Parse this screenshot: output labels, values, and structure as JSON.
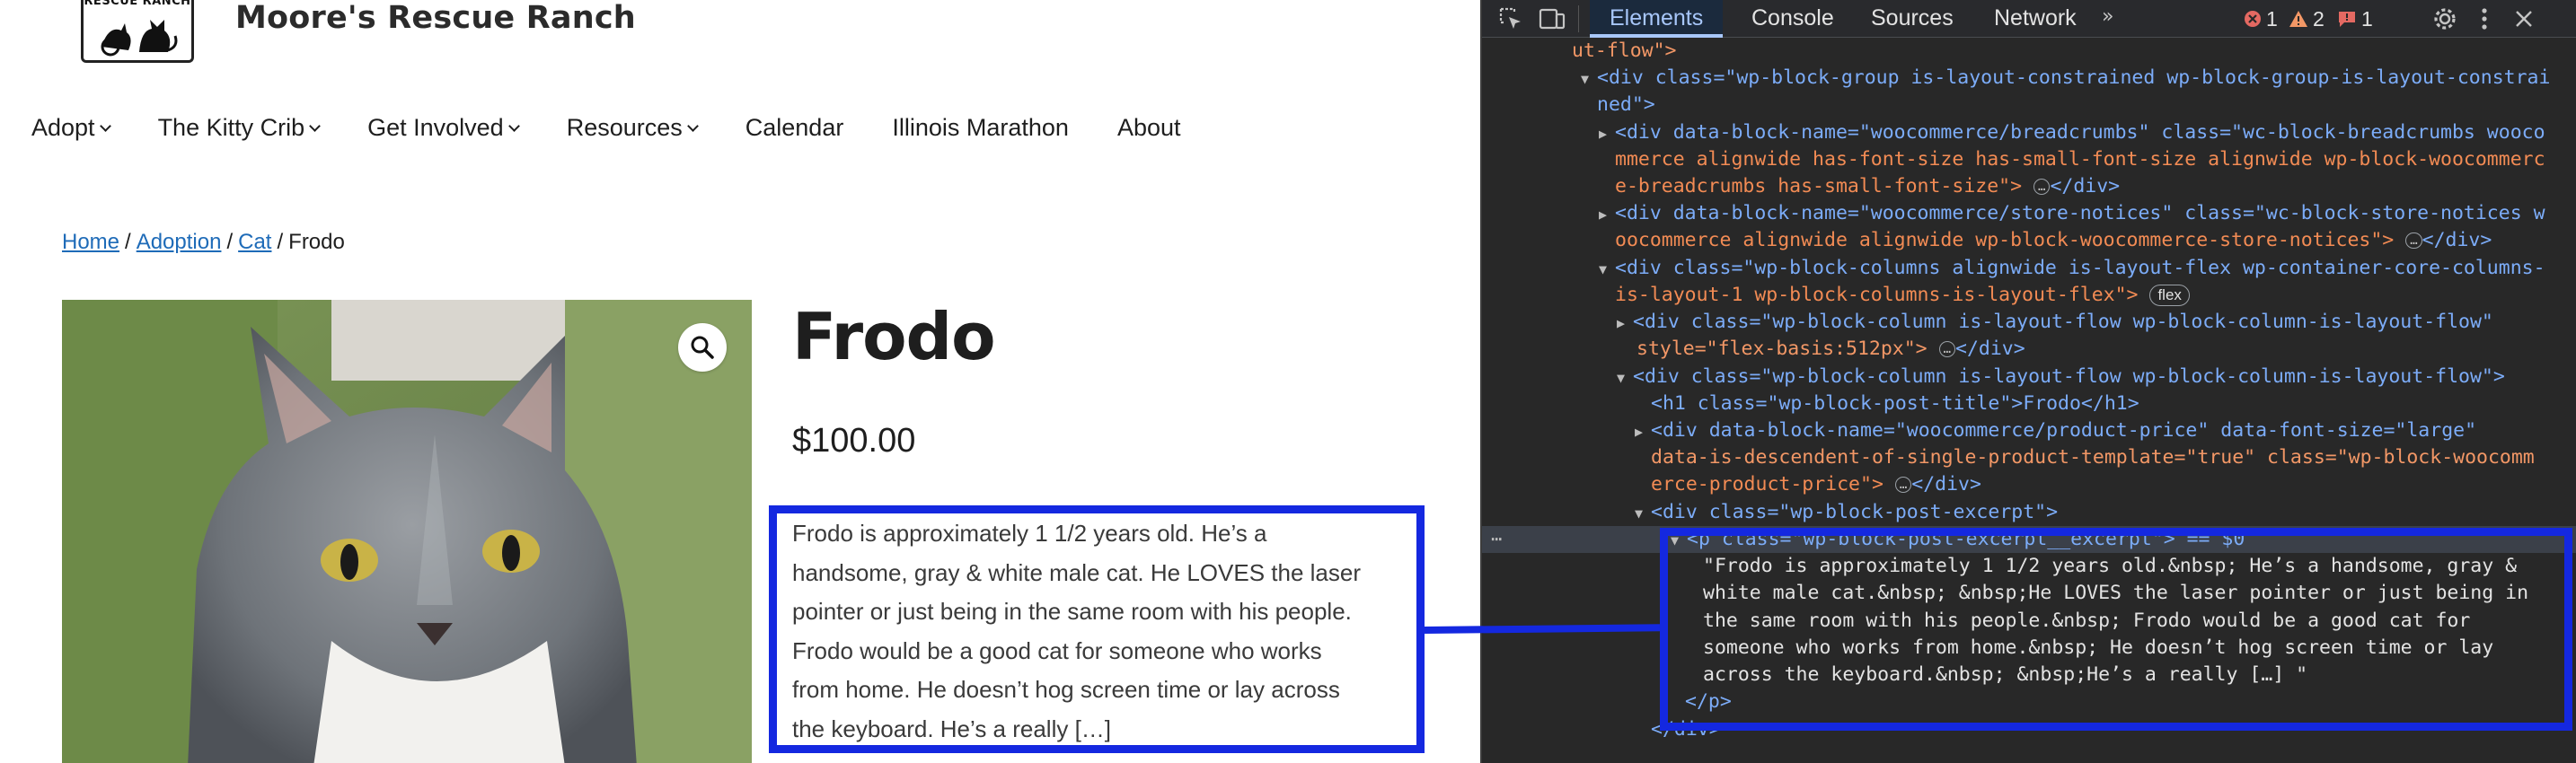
{
  "site": {
    "logo_text": "RESCUE RANCH",
    "title": "Moore's Rescue Ranch",
    "nav": [
      {
        "label": "Adopt",
        "has_dropdown": true
      },
      {
        "label": "The Kitty Crib",
        "has_dropdown": true
      },
      {
        "label": "Get Involved",
        "has_dropdown": true
      },
      {
        "label": "Resources",
        "has_dropdown": true
      },
      {
        "label": "Calendar",
        "has_dropdown": false
      },
      {
        "label": "Illinois Marathon",
        "has_dropdown": false
      },
      {
        "label": "About",
        "has_dropdown": false
      }
    ],
    "breadcrumb": {
      "links": [
        "Home",
        "Adoption",
        "Cat"
      ],
      "separator": "/",
      "current": "Frodo"
    },
    "product": {
      "title": "Frodo",
      "price": "$100.00",
      "excerpt_lines": [
        "Frodo is approximately 1 1/2 years old.  He’s a",
        "handsome, gray & white male cat.   He LOVES the laser",
        "pointer or just being in the same room with his people.",
        "Frodo would be a good cat for someone who works",
        "from home.  He doesn’t hog screen time or lay across",
        "the keyboard.   He’s a really […]"
      ],
      "zoom_icon": "magnifier-icon"
    },
    "highlight_color": "#1428e0"
  },
  "devtools": {
    "tabs": [
      "Elements",
      "Console",
      "Sources",
      "Network"
    ],
    "active_tab": "Elements",
    "more_tabs": "»",
    "errors": "1",
    "warnings": "2",
    "issues": "1",
    "lines": [
      {
        "text": "ut-flow\">"
      },
      {
        "text": "<div class=\"wp-block-group is-layout-constrained wp-block-group-is-layout-constrai"
      },
      {
        "text": "ned\">"
      },
      {
        "text": "<div data-block-name=\"woocommerce/breadcrumbs\" class=\"wc-block-breadcrumbs wooco"
      },
      {
        "text": "mmerce alignwide has-font-size has-small-font-size alignwide wp-block-woocommerc"
      },
      {
        "text": "e-breadcrumbs has-small-font-size\">"
      },
      {
        "text": "<div data-block-name=\"woocommerce/store-notices\" class=\"wc-block-store-notices w"
      },
      {
        "text": "oocommerce alignwide alignwide wp-block-woocommerce-store-notices\">"
      },
      {
        "text": "<div class=\"wp-block-columns alignwide is-layout-flex wp-container-core-columns-"
      },
      {
        "text": "is-layout-1 wp-block-columns-is-layout-flex\">"
      },
      {
        "text": "<div class=\"wp-block-column is-layout-flow wp-block-column-is-layout-flow\""
      },
      {
        "text": "style=\"flex-basis:512px\">"
      },
      {
        "text": "<div class=\"wp-block-column is-layout-flow wp-block-column-is-layout-flow\">"
      },
      {
        "text": "<h1 class=\"wp-block-post-title\">Frodo</h1>"
      },
      {
        "text": "<div data-block-name=\"woocommerce/product-price\" data-font-size=\"large\""
      },
      {
        "text": "data-is-descendent-of-single-product-template=\"true\" class=\"wp-block-woocomm"
      },
      {
        "text": "erce-product-price\">"
      },
      {
        "text": "<div class=\"wp-block-post-excerpt\">"
      },
      {
        "text": "<p class=\"wp-block-post-excerpt__excerpt\"> == $0"
      },
      {
        "text": "\"Frodo is approximately 1 1/2 years old.&nbsp; He’s a handsome, gray &"
      },
      {
        "text": "white male cat.&nbsp; &nbsp;He LOVES the laser pointer or just being in"
      },
      {
        "text": "the same room with his people.&nbsp; Frodo would be a good cat for"
      },
      {
        "text": "someone who works from home.&nbsp; He doesn’t hog screen time or lay"
      },
      {
        "text": "across the keyboard.&nbsp; &nbsp;He’s a really […] \""
      },
      {
        "text": "</p>"
      },
      {
        "text": "</div>"
      }
    ],
    "flex_badge": "flex",
    "ellipsis_badge": "…",
    "selected_marker": "== $0"
  }
}
